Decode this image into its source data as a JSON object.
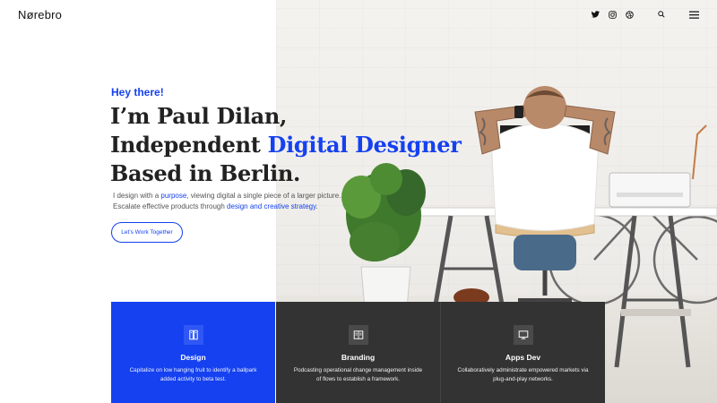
{
  "header": {
    "logo": "Nørebro",
    "social_icons": [
      "twitter-icon",
      "instagram-icon",
      "dribbble-icon"
    ],
    "search_icon": "search-icon",
    "menu_icon": "hamburger-menu-icon"
  },
  "hero": {
    "greeting": "Hey there!",
    "heading_line1": "I’m Paul Dilan,",
    "heading_line2_prefix": "Independent ",
    "heading_line2_highlight": "Digital Designer",
    "heading_line3": "Based in Berlin.",
    "desc_part1": "I design with a ",
    "desc_link1": "purpose",
    "desc_part2": ", viewing digital a single piece of a larger picture.",
    "desc_part3": "Escalate effective products through ",
    "desc_link2": "design and creative strategy",
    "desc_part4": ".",
    "cta_label": "Let’s Work Together"
  },
  "services": [
    {
      "title": "Design",
      "text": "Capitalize on low hanging fruit to identify a ballpark added activity to beta test.",
      "icon": "design-book-icon",
      "bg": "#1541f0"
    },
    {
      "title": "Branding",
      "text": "Podcasting operational change management inside of flows to establish a framework.",
      "icon": "branding-doc-icon",
      "bg": "#333333"
    },
    {
      "title": "Apps Dev",
      "text": "Collaboratively administrate empowered markets via plug-and-play networks.",
      "icon": "monitor-icon",
      "bg": "#333333"
    }
  ],
  "colors": {
    "accent": "#1541f0",
    "dark": "#333333",
    "text": "#222222"
  }
}
